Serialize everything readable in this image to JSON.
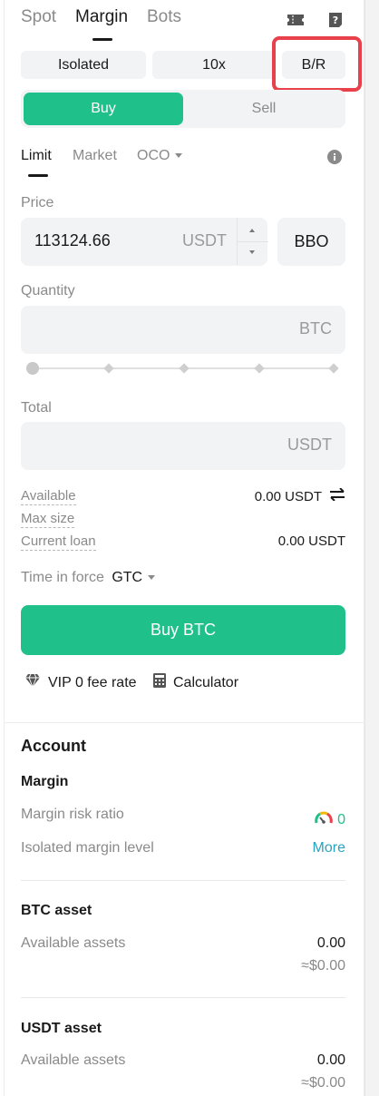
{
  "top_tabs": {
    "spot": "Spot",
    "margin": "Margin",
    "bots": "Bots"
  },
  "mode": {
    "isolated": "Isolated",
    "leverage": "10x",
    "borrow_repay": "B/R"
  },
  "side": {
    "buy": "Buy",
    "sell": "Sell"
  },
  "order_types": {
    "limit": "Limit",
    "market": "Market",
    "oco": "OCO"
  },
  "price": {
    "label": "Price",
    "value": "113124.66",
    "unit": "USDT",
    "bbo": "BBO"
  },
  "quantity": {
    "label": "Quantity",
    "unit": "BTC",
    "slider_percent": 0
  },
  "total": {
    "label": "Total",
    "unit": "USDT"
  },
  "info": {
    "available_label": "Available",
    "available_value": "0.00 USDT",
    "max_size_label": "Max size",
    "current_loan_label": "Current loan",
    "current_loan_value": "0.00 USDT"
  },
  "time_in_force": {
    "label": "Time in force",
    "value": "GTC"
  },
  "buy_button": "Buy BTC",
  "footer": {
    "vip": "VIP 0 fee rate",
    "calculator": "Calculator"
  },
  "account": {
    "title": "Account",
    "margin_title": "Margin",
    "risk_ratio_label": "Margin risk ratio",
    "risk_ratio_value": "0",
    "isolated_level_label": "Isolated margin level",
    "more": "More",
    "btc_title": "BTC asset",
    "btc_available_label": "Available assets",
    "btc_available_value": "0.00",
    "btc_fiat": "≈$0.00",
    "usdt_title": "USDT asset",
    "usdt_available_label": "Available assets",
    "usdt_available_value": "0.00",
    "usdt_fiat": "≈$0.00"
  },
  "colors": {
    "accent_green": "#1fc08a",
    "highlight_red": "#e8414b",
    "link_blue": "#2aa2c0"
  },
  "icons": [
    "ticket-icon",
    "help-icon",
    "info-icon",
    "swap-icon",
    "diamond-icon",
    "calculator-icon",
    "gauge-icon"
  ]
}
